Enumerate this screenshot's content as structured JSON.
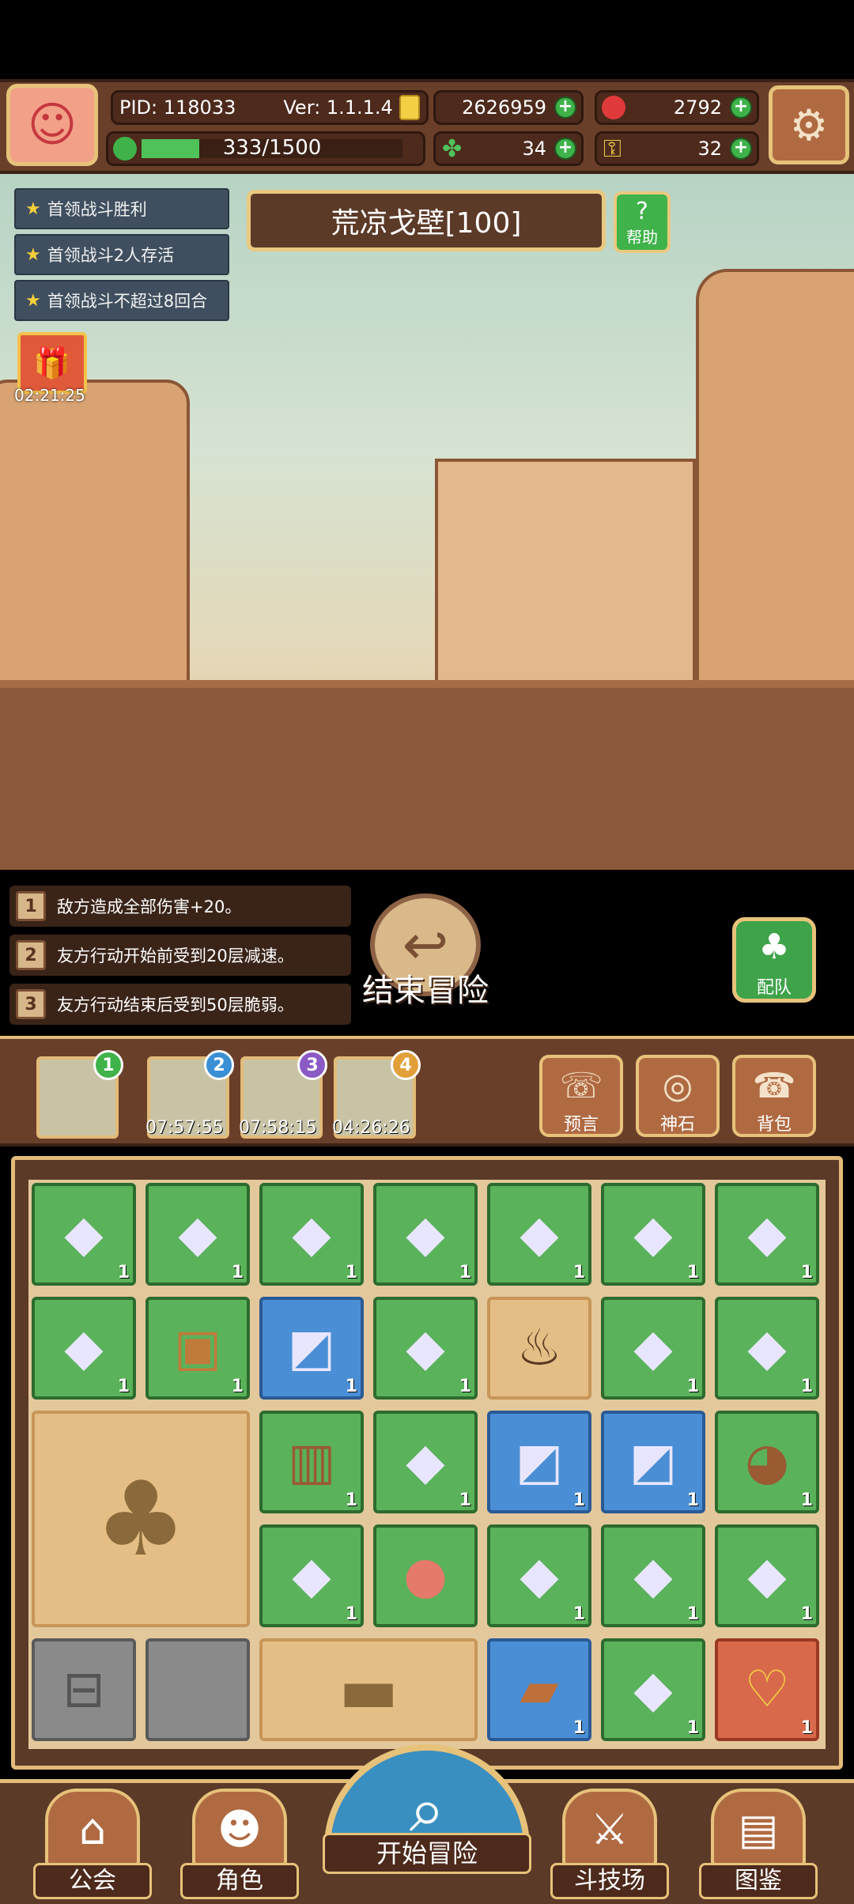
{
  "header": {
    "pid_label": "PID: 118033",
    "version_label": "Ver: 1.1.1.4",
    "coins": "2626959",
    "gems": "2792",
    "exp": "333/1500",
    "exp_progress": 0.222,
    "clover": "34",
    "keys": "32"
  },
  "missions": [
    "首领战斗胜利",
    "首领战斗2人存活",
    "首领战斗不超过8回合"
  ],
  "stage": {
    "title": "荒凉戈壁[100]",
    "help_label": "帮助"
  },
  "gift": {
    "timer": "02:21:25"
  },
  "effects": [
    {
      "num": "1",
      "text": "敌方造成全部伤害+20。"
    },
    {
      "num": "2",
      "text": "友方行动开始前受到20层减速。"
    },
    {
      "num": "3",
      "text": "友方行动结束后受到50层脆弱。"
    }
  ],
  "actions": {
    "end_adventure": "结束冒险",
    "team": "配队"
  },
  "slots": [
    {
      "badge": "1",
      "color": "#3fb24a",
      "time": ""
    },
    {
      "badge": "2",
      "color": "#3a8fd5",
      "time": "07:57:55"
    },
    {
      "badge": "3",
      "color": "#8a5ac5",
      "time": "07:58:15"
    },
    {
      "badge": "4",
      "color": "#e2a03a",
      "time": "04:26:26"
    }
  ],
  "tools": [
    "预言",
    "神石",
    "背包"
  ],
  "inventory_count": "1",
  "nav": {
    "guild": "公会",
    "character": "角色",
    "start": "开始冒险",
    "arena": "斗技场",
    "codex": "图鉴"
  },
  "icons": [
    "settings-gear-icon",
    "coin-icon",
    "ruby-icon",
    "clover-icon",
    "key-icon",
    "crystal-icon",
    "treasure-chest-icon",
    "backpack-icon"
  ]
}
